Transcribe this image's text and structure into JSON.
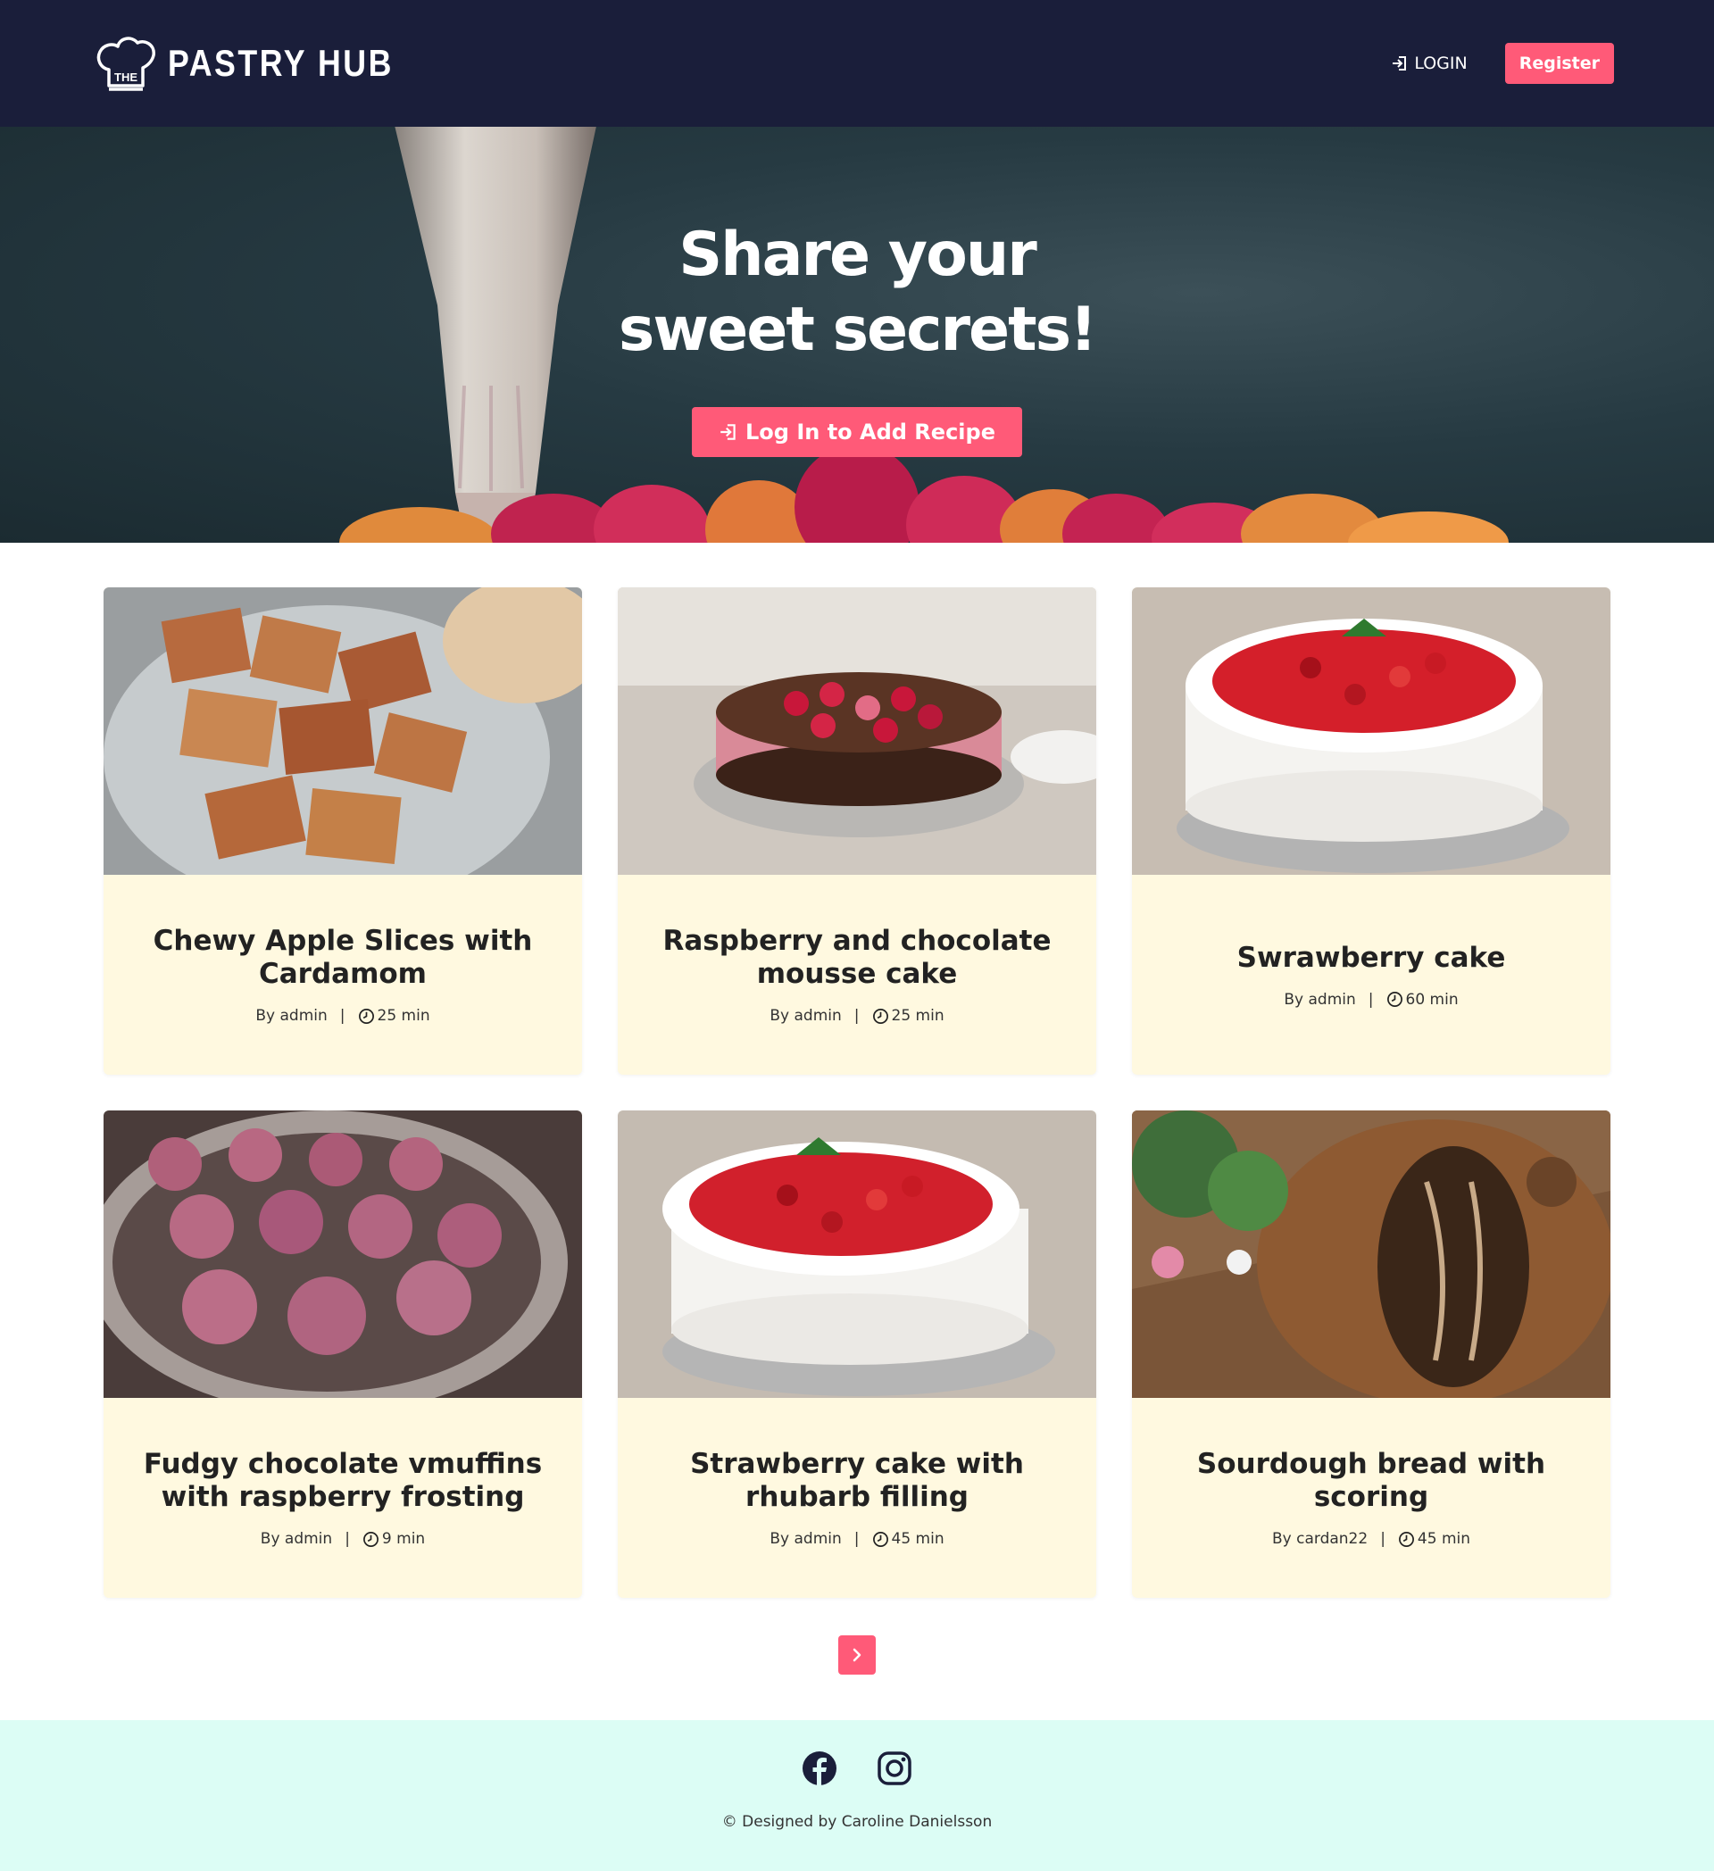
{
  "brand": {
    "logo_text": "THE",
    "name": "PASTRY HUB"
  },
  "nav": {
    "login_label": "LOGIN",
    "register_label": "Register"
  },
  "hero": {
    "title": "Share your sweet secrets!",
    "cta_label": "Log In to Add Recipe"
  },
  "recipes": [
    {
      "title": "Chewy Apple Slices with Cardamom",
      "author": "By admin",
      "time": "25 min",
      "image": "apple-slices-photo"
    },
    {
      "title": "Raspberry and chocolate mousse cake",
      "author": "By admin",
      "time": "25 min",
      "image": "mousse-cake-photo"
    },
    {
      "title": "Swrawberry cake",
      "author": "By admin",
      "time": "60 min",
      "image": "strawberry-cake-photo"
    },
    {
      "title": "Fudgy chocolate vmuffins with raspberry frosting",
      "author": "By admin",
      "time": "9 min",
      "image": "muffins-photo"
    },
    {
      "title": "Strawberry cake with rhubarb filling",
      "author": "By admin",
      "time": "45 min",
      "image": "rhubarb-cake-photo"
    },
    {
      "title": "Sourdough bread with scoring",
      "author": "By cardan22",
      "time": "45 min",
      "image": "sourdough-photo"
    }
  ],
  "meta_separator": "|",
  "pagination": {
    "next_icon": "chevron-right-icon"
  },
  "footer": {
    "icons": [
      "facebook-icon",
      "instagram-icon"
    ],
    "credit": "© Designed by Caroline Danielsson"
  },
  "colors": {
    "navy": "#1a1e3a",
    "accent": "#ff5a78",
    "card_bg": "#fff9e0",
    "footer_bg": "#dcfdf5"
  }
}
